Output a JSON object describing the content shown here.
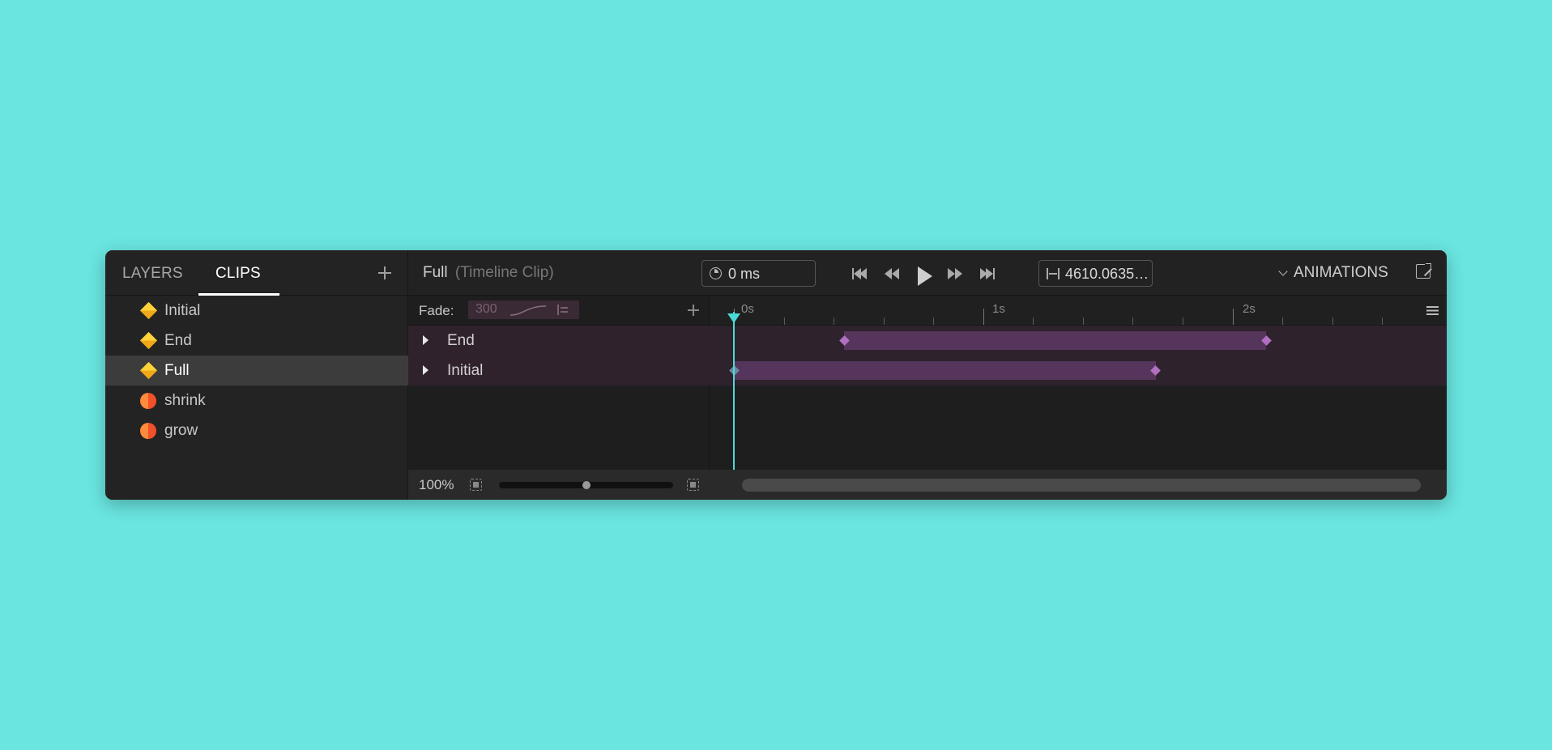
{
  "sidebar": {
    "tabs": [
      {
        "label": "LAYERS",
        "active": false
      },
      {
        "label": "CLIPS",
        "active": true
      }
    ],
    "clips": [
      {
        "label": "Initial",
        "icon": "timeline-clip-diamond-icon",
        "selected": false
      },
      {
        "label": "End",
        "icon": "timeline-clip-diamond-icon",
        "selected": false
      },
      {
        "label": "Full",
        "icon": "timeline-clip-diamond-icon",
        "selected": true
      },
      {
        "label": "shrink",
        "icon": "animation-clip-circle-icon",
        "selected": false
      },
      {
        "label": "grow",
        "icon": "animation-clip-circle-icon",
        "selected": false
      }
    ]
  },
  "header": {
    "clip_name": "Full",
    "clip_type": "(Timeline Clip)",
    "current_time": "0 ms",
    "duration": "4610.0635…",
    "animations_label": "ANIMATIONS"
  },
  "tracks": {
    "fade_label": "Fade:",
    "fade_value": "300",
    "rows": [
      {
        "label": "End"
      },
      {
        "label": "Initial"
      }
    ]
  },
  "timeline": {
    "ruler_labels": [
      "0s",
      "1s",
      "2s"
    ],
    "clips": [
      {
        "track": "End",
        "start_s": 0.54,
        "end_s": 2.6
      },
      {
        "track": "Initial",
        "start_s": 0.0,
        "end_s": 2.06
      }
    ],
    "playhead_s": 0
  },
  "footer": {
    "zoom": "100%",
    "zoom_slider_fraction": 0.5
  },
  "colors": {
    "background": "#6ae5e0",
    "panel": "#1e1e1e",
    "accent": "#4cd9d4",
    "clip_bar": "#56355c",
    "keyframe": "#b070c0",
    "diamond_icon": "#ffd23a",
    "circle_icon": "#f0502a"
  }
}
